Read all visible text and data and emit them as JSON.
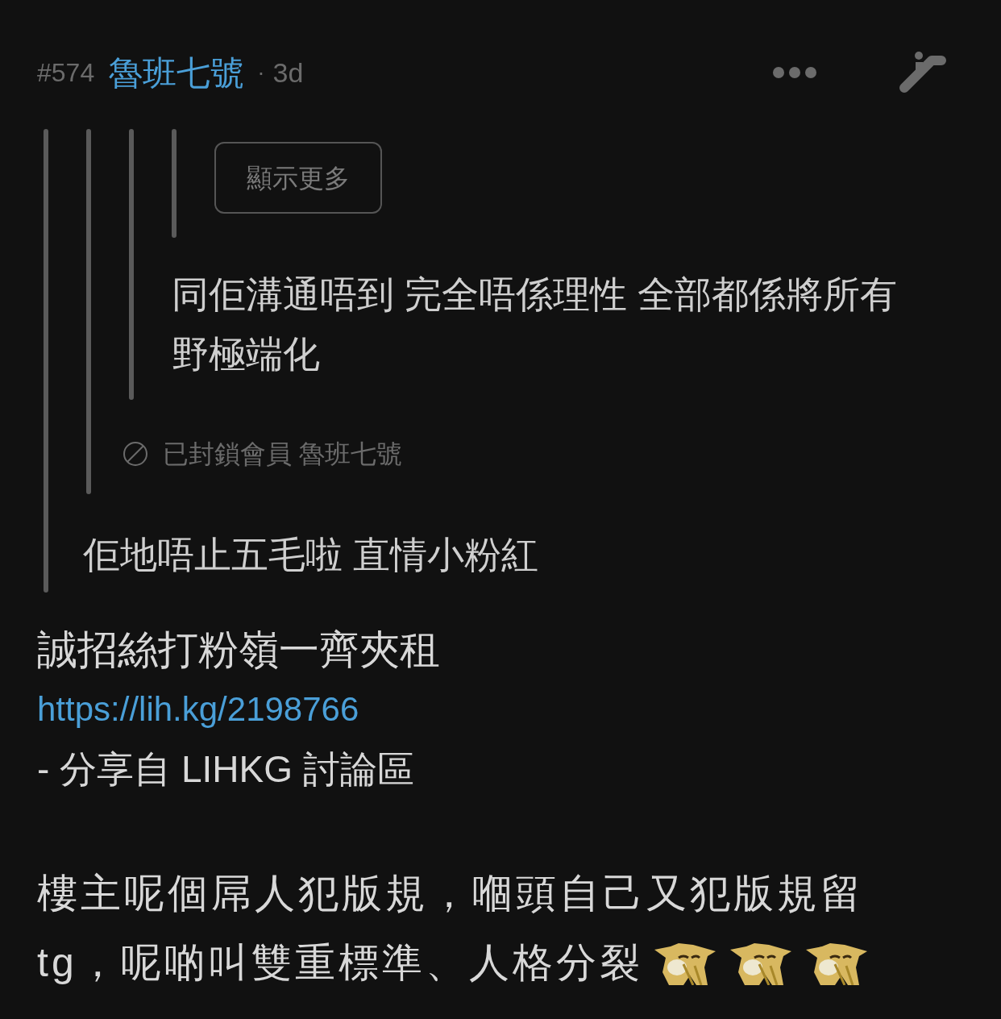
{
  "header": {
    "number": "#574",
    "author": "魯班七號",
    "separator": "·",
    "time": "3d"
  },
  "quote": {
    "quote": {
      "quote": {
        "quote": {
          "button": "顯示更多"
        },
        "text": "同佢溝通唔到 完全唔係理性 全部都係將所有野極端化"
      },
      "blocked": "已封鎖會員 魯班七號"
    },
    "text": "佢地唔止五毛啦 直情小粉紅"
  },
  "body": {
    "lines": [
      "誠招絲打粉嶺一齊夾租"
    ],
    "link": "https://lih.kg/2198766",
    "share_line": "- 分享自 LIHKG 討論區",
    "paragraph_lines": [
      "樓主呢個屌人犯版規，嗰頭自己又犯版規留",
      "tg，呢啲叫雙重標準、人格分裂"
    ],
    "emojis": [
      {
        "kind": "dog"
      },
      {
        "kind": "dog"
      },
      {
        "kind": "dog"
      }
    ]
  }
}
